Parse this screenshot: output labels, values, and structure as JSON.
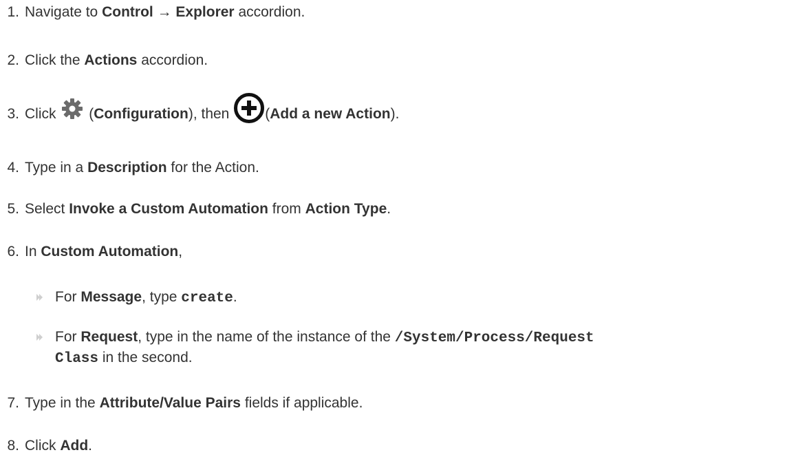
{
  "steps": [
    {
      "num": "1.",
      "parts": [
        "Navigate to ",
        "Control",
        " → ",
        "Explorer",
        " accordion."
      ]
    },
    {
      "num": "2.",
      "parts": [
        "Click the ",
        "Actions",
        " accordion."
      ]
    },
    {
      "num": "3.",
      "parts": [
        "Click ",
        "(",
        "Configuration",
        "), then ",
        "(",
        "Add a new Action",
        ")."
      ],
      "icons": [
        "gear-icon",
        "plus-circle-icon"
      ]
    },
    {
      "num": "4.",
      "parts": [
        "Type in a ",
        "Description",
        " for the Action."
      ]
    },
    {
      "num": "5.",
      "parts": [
        "Select ",
        "Invoke a Custom Automation",
        " from ",
        "Action Type",
        "."
      ]
    },
    {
      "num": "6.",
      "parts": [
        "In ",
        "Custom Automation",
        ","
      ]
    },
    {
      "num": "7.",
      "parts": [
        "Type in the ",
        "Attribute/Value Pairs",
        " fields if applicable."
      ]
    },
    {
      "num": "8.",
      "parts": [
        "Click ",
        "Add",
        "."
      ]
    }
  ],
  "substeps": [
    {
      "parts": [
        "For ",
        "Message",
        ", type ",
        "create",
        "."
      ]
    },
    {
      "parts": [
        "For ",
        "Request",
        ", type in the name of the instance of the ",
        "/System/Process/Request"
      ]
    },
    {
      "parts": [
        "Class",
        " in the second."
      ]
    }
  ]
}
